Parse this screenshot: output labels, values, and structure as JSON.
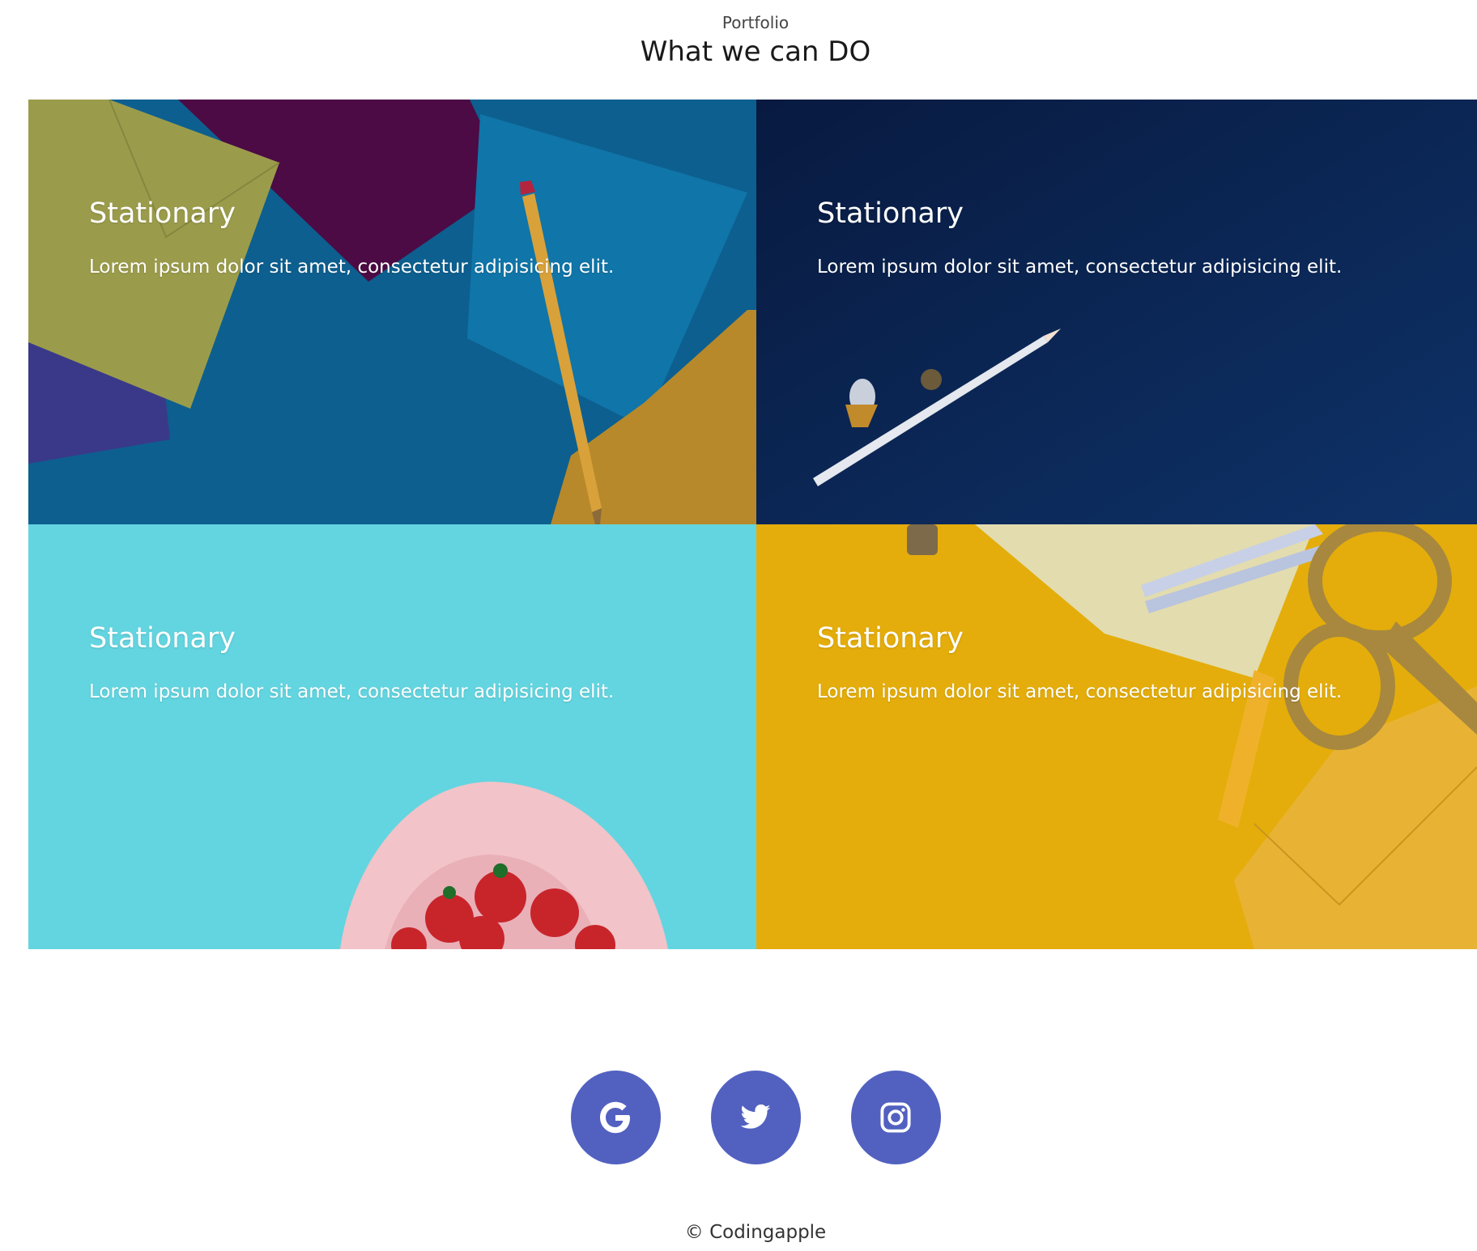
{
  "header": {
    "eyebrow": "Portfolio",
    "title": "What we can DO"
  },
  "tiles": [
    {
      "heading": "Stationary",
      "description": "Lorem ipsum dolor sit amet, consectetur adipisicing elit.",
      "background_color": "#0d5f8f"
    },
    {
      "heading": "Stationary",
      "description": "Lorem ipsum dolor sit amet, consectetur adipisicing elit.",
      "background_color": "#0c2b5e"
    },
    {
      "heading": "Stationary",
      "description": "Lorem ipsum dolor sit amet, consectetur adipisicing elit.",
      "background_color": "#63d5e0"
    },
    {
      "heading": "Stationary",
      "description": "Lorem ipsum dolor sit amet, consectetur adipisicing elit.",
      "background_color": "#e4ad0b"
    }
  ],
  "social": {
    "button_color": "#5261c0",
    "items": [
      {
        "name": "google",
        "icon": "google-icon"
      },
      {
        "name": "twitter",
        "icon": "twitter-icon"
      },
      {
        "name": "instagram",
        "icon": "instagram-icon"
      }
    ]
  },
  "footer": {
    "copyright": "© Codingapple"
  }
}
